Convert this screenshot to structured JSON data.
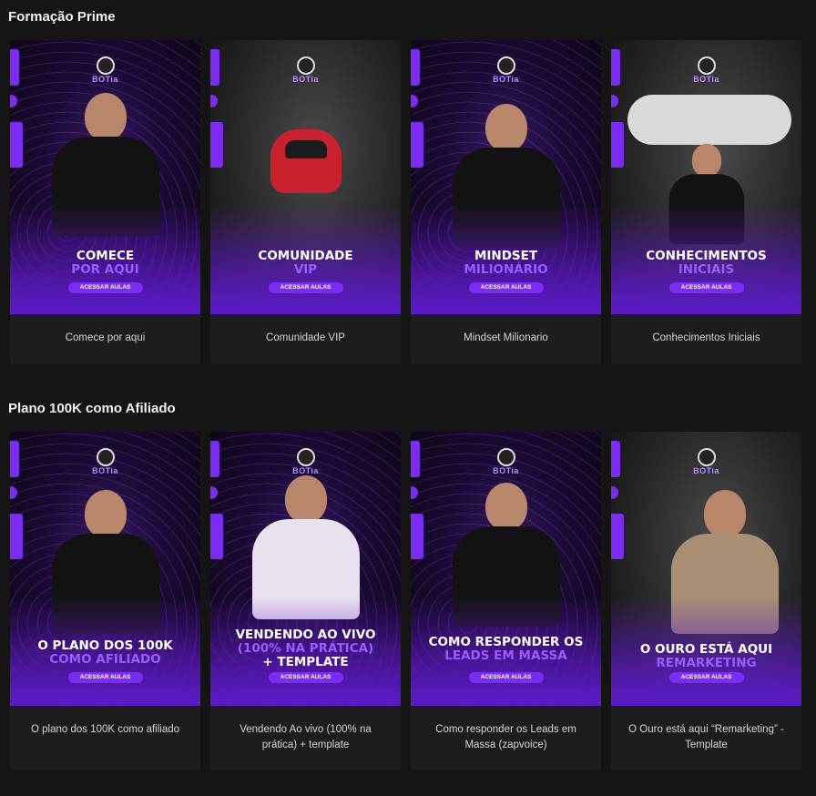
{
  "sections": [
    {
      "title": "Formação Prime",
      "cards": [
        {
          "line1": "COMECE",
          "line2": "POR AQUI",
          "line3": "",
          "button": "ACESSAR AULAS",
          "caption": "Comece por aqui"
        },
        {
          "line1": "COMUNIDADE",
          "line2": "VIP",
          "line3": "",
          "button": "ACESSAR AULAS",
          "caption": "Comunidade VIP"
        },
        {
          "line1": "MINDSET",
          "line2": "MILIONÁRIO",
          "line3": "",
          "button": "ACESSAR AULAS",
          "caption": "Mindset Milionario"
        },
        {
          "line1": "CONHECIMENTOS",
          "line2": "INICIAIS",
          "line3": "",
          "button": "ACESSAR AULAS",
          "caption": "Conhecimentos Iniciais"
        }
      ]
    },
    {
      "title": "Plano 100K como Afiliado",
      "cards": [
        {
          "line1": "O PLANO DOS 100K",
          "line2": "COMO AFILIADO",
          "line3": "",
          "button": "ACESSAR AULAS",
          "caption": "O plano dos 100K como afiliado"
        },
        {
          "line1": "VENDENDO AO VIVO",
          "line2": "(100% NA PRÁTICA)",
          "line3": "+ TEMPLATE",
          "button": "ACESSAR AULAS",
          "caption": "Vendendo Ao vivo (100% na prática) + template"
        },
        {
          "line1": "COMO RESPONDER OS",
          "line2": "LEADS EM MASSA",
          "line3": "",
          "button": "ACESSAR AULAS",
          "caption": "Como responder os Leads em Massa (zapvoice)"
        },
        {
          "line1": "O OURO ESTÁ AQUI",
          "line2": "REMARKETING",
          "line3": "",
          "button": "ACESSAR AULAS",
          "caption": "O Ouro está aqui “Remarketing” - Template"
        }
      ]
    }
  ],
  "brand": {
    "logo_text": "BOTia",
    "accent": "#7a2cf2",
    "accent_text": "#9b5cff"
  }
}
